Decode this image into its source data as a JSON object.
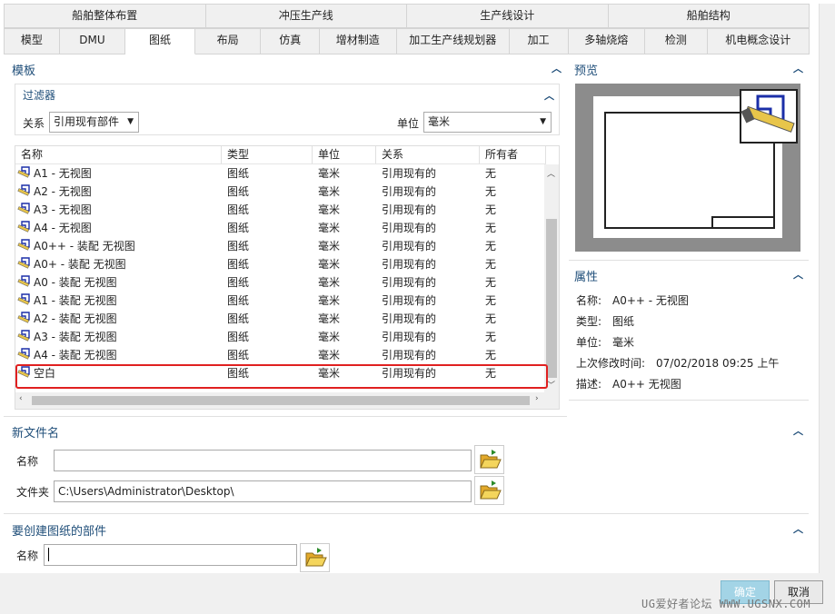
{
  "tabs_row1": [
    "船舶整体布置",
    "冲压生产线",
    "生产线设计",
    "船舶结构"
  ],
  "tabs_row2": [
    "模型",
    "DMU",
    "图纸",
    "布局",
    "仿真",
    "增材制造",
    "加工生产线规划器",
    "加工",
    "多轴烧熔",
    "检测",
    "机电概念设计"
  ],
  "template": {
    "title": "模板",
    "filter": {
      "title": "过滤器",
      "relation_label": "关系",
      "relation_value": "引用现有部件",
      "unit_label": "单位",
      "unit_value": "毫米"
    },
    "columns": [
      "名称",
      "类型",
      "单位",
      "关系",
      "所有者"
    ],
    "rows": [
      [
        "A1 - 无视图",
        "图纸",
        "毫米",
        "引用现有的",
        "无"
      ],
      [
        "A2 - 无视图",
        "图纸",
        "毫米",
        "引用现有的",
        "无"
      ],
      [
        "A3 - 无视图",
        "图纸",
        "毫米",
        "引用现有的",
        "无"
      ],
      [
        "A4 - 无视图",
        "图纸",
        "毫米",
        "引用现有的",
        "无"
      ],
      [
        "A0++ - 装配 无视图",
        "图纸",
        "毫米",
        "引用现有的",
        "无"
      ],
      [
        "A0+ - 装配 无视图",
        "图纸",
        "毫米",
        "引用现有的",
        "无"
      ],
      [
        "A0 - 装配 无视图",
        "图纸",
        "毫米",
        "引用现有的",
        "无"
      ],
      [
        "A1 - 装配 无视图",
        "图纸",
        "毫米",
        "引用现有的",
        "无"
      ],
      [
        "A2 - 装配 无视图",
        "图纸",
        "毫米",
        "引用现有的",
        "无"
      ],
      [
        "A3 - 装配 无视图",
        "图纸",
        "毫米",
        "引用现有的",
        "无"
      ],
      [
        "A4 - 装配 无视图",
        "图纸",
        "毫米",
        "引用现有的",
        "无"
      ],
      [
        "空白",
        "图纸",
        "毫米",
        "引用现有的",
        "无"
      ]
    ]
  },
  "preview": {
    "title": "预览"
  },
  "properties": {
    "title": "属性",
    "items": [
      {
        "label": "名称:",
        "value": "A0++ - 无视图"
      },
      {
        "label": "类型:",
        "value": "图纸"
      },
      {
        "label": "单位:",
        "value": "毫米"
      },
      {
        "label": "上次修改时间:",
        "value": "07/02/2018 09:25 上午"
      },
      {
        "label": "描述:",
        "value": "A0++ 无视图"
      }
    ]
  },
  "new_file": {
    "title": "新文件名",
    "name_label": "名称",
    "name_value": "",
    "folder_label": "文件夹",
    "folder_value": "C:\\Users\\Administrator\\Desktop\\"
  },
  "part": {
    "title": "要创建图纸的部件",
    "name_label": "名称",
    "name_value": ""
  },
  "buttons": {
    "ok": "确定",
    "cancel": "取消"
  },
  "watermark": "UG爱好者论坛 WWW.UGSNX.COM",
  "colors": {
    "accent": "#1f4e79",
    "highlight": "#e02020",
    "ok_button": "#a3d4e6"
  }
}
